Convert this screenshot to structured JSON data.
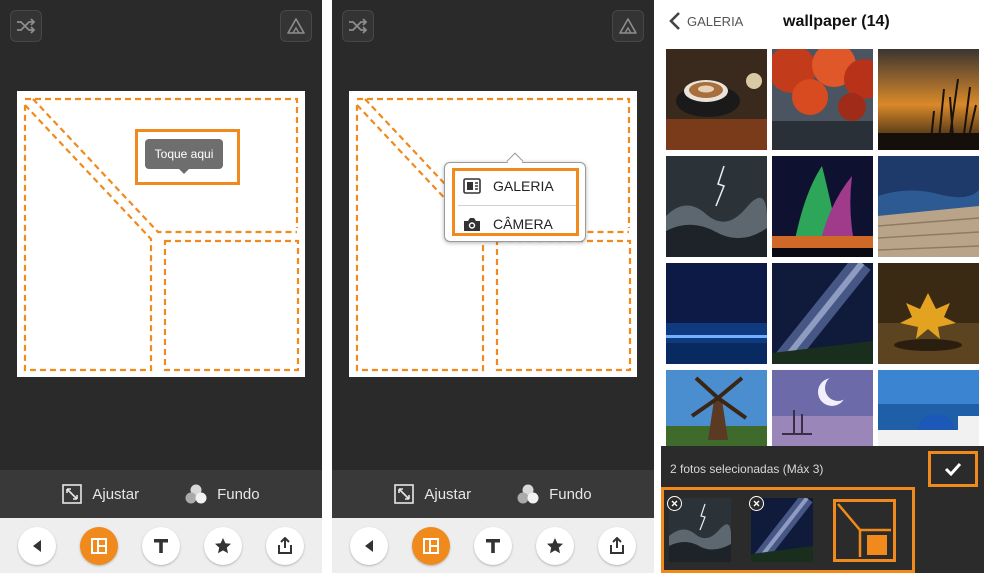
{
  "editor": {
    "tooltip": "Toque aqui",
    "adjust_label": "Ajustar",
    "background_label": "Fundo"
  },
  "source_menu": {
    "gallery_label": "GALERIA",
    "camera_label": "CÂMERA"
  },
  "gallery": {
    "back_label": "GALERIA",
    "title": "wallpaper (14)",
    "selection_text": "2 fotos selecionadas (Máx 3)"
  },
  "colors": {
    "accent": "#f08a1c",
    "dark_bg": "#2a2a2a",
    "toolbar_bg": "#393939"
  },
  "icons": [
    "shuffle-icon",
    "recycle-icon",
    "resize-icon",
    "circles-icon",
    "back-icon",
    "layout-icon",
    "text-icon",
    "star-icon",
    "share-icon",
    "gallery-icon",
    "camera-icon",
    "chevron-left-icon",
    "check-icon",
    "close-icon"
  ]
}
